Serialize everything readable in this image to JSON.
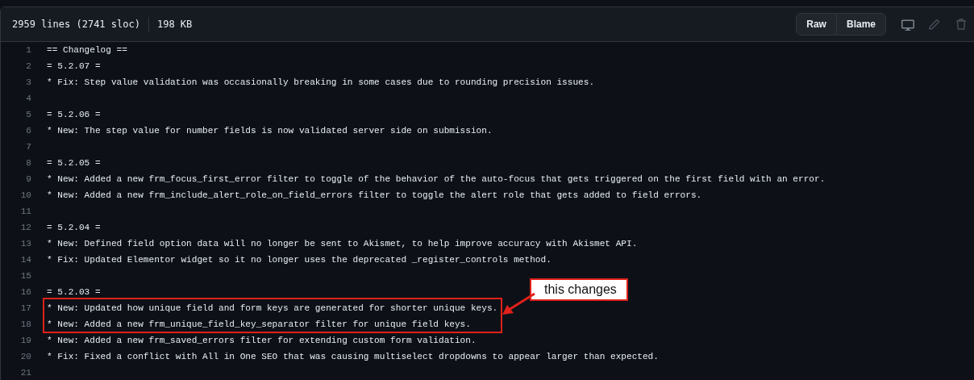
{
  "file_info": {
    "lines": "2959 lines (2741 sloc)",
    "size": "198 KB"
  },
  "toolbar": {
    "buttons": [
      "Raw",
      "Blame"
    ]
  },
  "code_lines": [
    {
      "number": "1",
      "text": "== Changelog ==",
      "highlighted": false
    },
    {
      "number": "2",
      "text": "= 5.2.07 =",
      "highlighted": false
    },
    {
      "number": "3",
      "text": "* Fix: Step value validation was occasionally breaking in some cases due to rounding precision issues.",
      "highlighted": false
    },
    {
      "number": "4",
      "highlighted": false
    },
    {
      "number": "5",
      "text": "= 5.2.06 =",
      "highlighted": false
    },
    {
      "number": "6",
      "text": "* New: The step value for number fields is now validated server side on submission.",
      "highlighted": false
    },
    {
      "number": "7",
      "highlighted": false
    },
    {
      "number": "8",
      "text": "= 5.2.05 =",
      "highlighted": false
    },
    {
      "number": "9",
      "text": "* New: Added a new frm_focus_first_error filter to toggle of the behavior of the auto-focus that gets triggered on the first field with an error.",
      "highlighted": false
    },
    {
      "number": "10",
      "text": "* New: Added a new frm_include_alert_role_on_field_errors filter to toggle the alert role that gets added to field errors.",
      "highlighted": false
    },
    {
      "number": "11",
      "highlighted": false
    },
    {
      "number": "12",
      "text": "= 5.2.04 =",
      "highlighted": false
    },
    {
      "number": "13",
      "text": "* New: Defined field option data will no longer be sent to Akismet, to help improve accuracy with Akismet API.",
      "highlighted": false
    },
    {
      "number": "14",
      "text": "* Fix: Updated Elementor widget so it no longer uses the deprecated _register_controls method.",
      "highlighted": false
    },
    {
      "number": "15",
      "highlighted": false
    },
    {
      "number": "16",
      "text": "= 5.2.03 =",
      "highlighted": false
    },
    {
      "number": "17",
      "text": "* New: Updated how unique field and form keys are generated for shorter unique keys.",
      "highlighted": true
    },
    {
      "number": "18",
      "text": "* New: Added a new frm_unique_field_key_separator filter for unique field keys.",
      "highlighted": true
    },
    {
      "number": "19",
      "text": "* New: Added a new frm_saved_errors filter for extending custom form validation.",
      "highlighted": false
    },
    {
      "number": "20",
      "text": "* Fix: Fixed a conflict with All in One SEO that was causing multiselect dropdowns to appear larger than expected.",
      "highlighted": false
    },
    {
      "number": "21",
      "highlighted": false
    }
  ],
  "annotation": {
    "label": "this changes"
  }
}
